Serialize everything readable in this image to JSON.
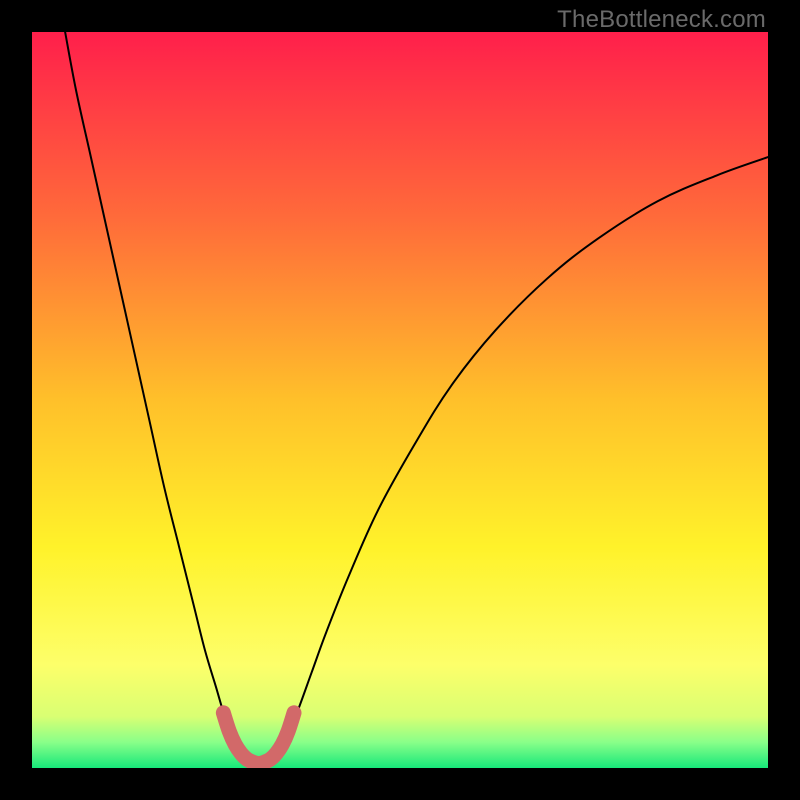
{
  "watermark": "TheBottleneck.com",
  "chart_data": {
    "type": "line",
    "title": "",
    "xlabel": "",
    "ylabel": "",
    "xlim": [
      0,
      1
    ],
    "ylim": [
      0,
      1
    ],
    "grid": false,
    "legend": false,
    "background_gradient": {
      "stops": [
        {
          "offset": 0.0,
          "color": "#ff1f4b"
        },
        {
          "offset": 0.25,
          "color": "#ff6a3a"
        },
        {
          "offset": 0.5,
          "color": "#ffc02a"
        },
        {
          "offset": 0.7,
          "color": "#fff22a"
        },
        {
          "offset": 0.86,
          "color": "#fdff6a"
        },
        {
          "offset": 0.93,
          "color": "#d9ff73"
        },
        {
          "offset": 0.965,
          "color": "#89ff89"
        },
        {
          "offset": 1.0,
          "color": "#17e87a"
        }
      ]
    },
    "series": [
      {
        "name": "curve",
        "stroke": "#000000",
        "points": [
          {
            "x": 0.045,
            "y": 1.0
          },
          {
            "x": 0.06,
            "y": 0.92
          },
          {
            "x": 0.08,
            "y": 0.83
          },
          {
            "x": 0.1,
            "y": 0.74
          },
          {
            "x": 0.12,
            "y": 0.65
          },
          {
            "x": 0.14,
            "y": 0.56
          },
          {
            "x": 0.16,
            "y": 0.47
          },
          {
            "x": 0.18,
            "y": 0.38
          },
          {
            "x": 0.2,
            "y": 0.3
          },
          {
            "x": 0.22,
            "y": 0.22
          },
          {
            "x": 0.235,
            "y": 0.16
          },
          {
            "x": 0.25,
            "y": 0.11
          },
          {
            "x": 0.262,
            "y": 0.07
          },
          {
            "x": 0.275,
            "y": 0.04
          },
          {
            "x": 0.285,
            "y": 0.02
          },
          {
            "x": 0.295,
            "y": 0.01
          },
          {
            "x": 0.305,
            "y": 0.005
          },
          {
            "x": 0.315,
            "y": 0.005
          },
          {
            "x": 0.325,
            "y": 0.01
          },
          {
            "x": 0.335,
            "y": 0.02
          },
          {
            "x": 0.345,
            "y": 0.04
          },
          {
            "x": 0.36,
            "y": 0.075
          },
          {
            "x": 0.38,
            "y": 0.13
          },
          {
            "x": 0.4,
            "y": 0.185
          },
          {
            "x": 0.43,
            "y": 0.26
          },
          {
            "x": 0.47,
            "y": 0.35
          },
          {
            "x": 0.52,
            "y": 0.44
          },
          {
            "x": 0.57,
            "y": 0.52
          },
          {
            "x": 0.63,
            "y": 0.595
          },
          {
            "x": 0.7,
            "y": 0.665
          },
          {
            "x": 0.77,
            "y": 0.72
          },
          {
            "x": 0.85,
            "y": 0.77
          },
          {
            "x": 0.93,
            "y": 0.805
          },
          {
            "x": 1.0,
            "y": 0.83
          }
        ]
      },
      {
        "name": "highlight",
        "stroke": "#d26969",
        "points": [
          {
            "x": 0.26,
            "y": 0.075
          },
          {
            "x": 0.268,
            "y": 0.05
          },
          {
            "x": 0.276,
            "y": 0.032
          },
          {
            "x": 0.284,
            "y": 0.02
          },
          {
            "x": 0.292,
            "y": 0.012
          },
          {
            "x": 0.3,
            "y": 0.008
          },
          {
            "x": 0.308,
            "y": 0.006
          },
          {
            "x": 0.316,
            "y": 0.008
          },
          {
            "x": 0.324,
            "y": 0.012
          },
          {
            "x": 0.332,
            "y": 0.02
          },
          {
            "x": 0.34,
            "y": 0.032
          },
          {
            "x": 0.348,
            "y": 0.05
          },
          {
            "x": 0.356,
            "y": 0.075
          }
        ]
      }
    ]
  }
}
